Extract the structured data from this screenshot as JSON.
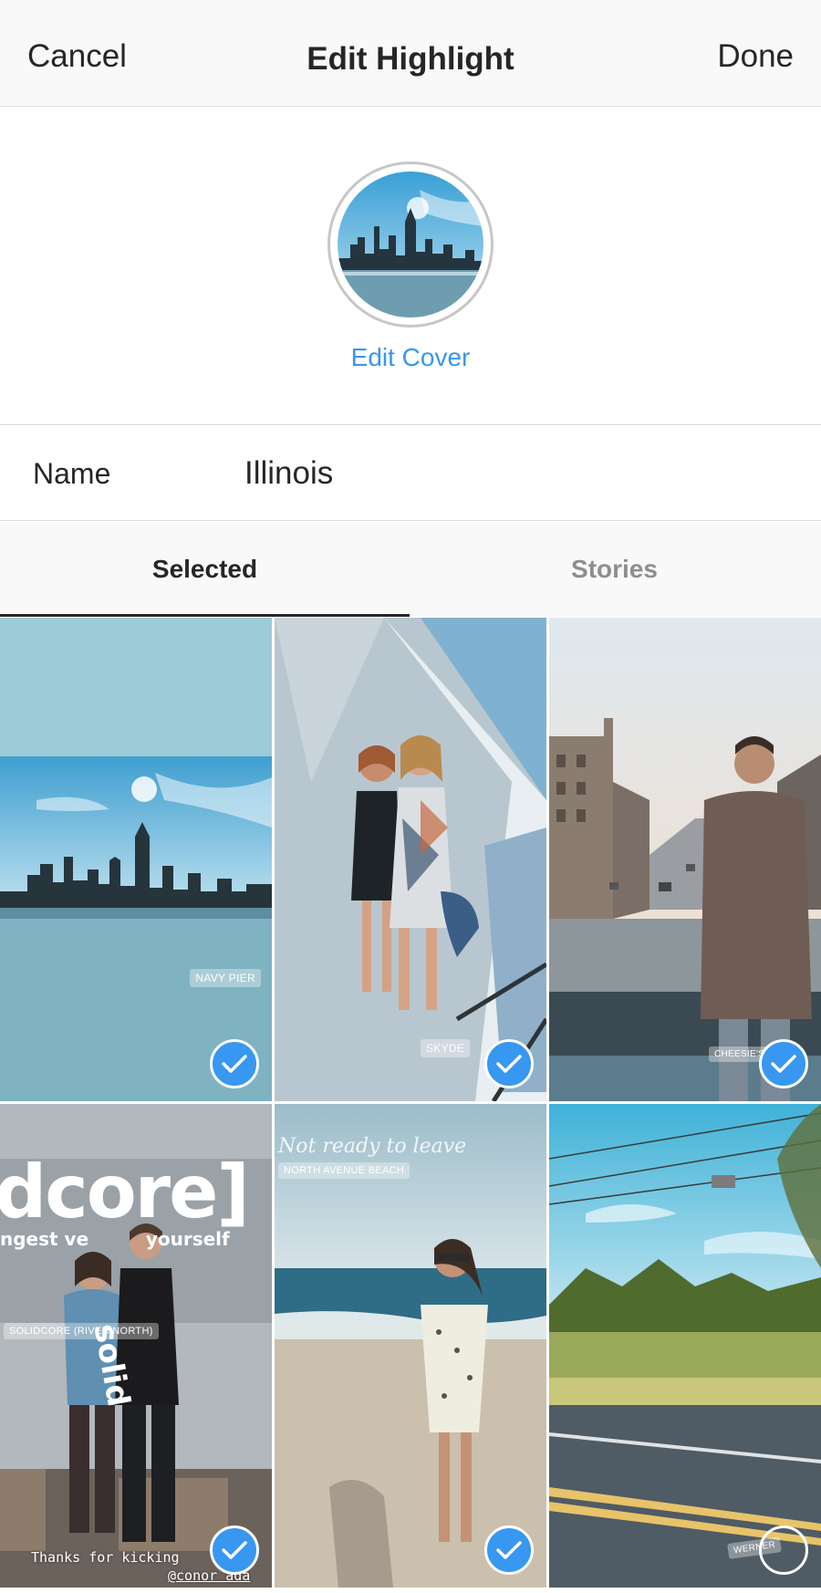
{
  "header": {
    "cancel_label": "Cancel",
    "title": "Edit Highlight",
    "done_label": "Done"
  },
  "cover": {
    "edit_label": "Edit Cover"
  },
  "name_field": {
    "label": "Name",
    "value": "Illinois"
  },
  "tabs": [
    {
      "label": "Selected",
      "active": true
    },
    {
      "label": "Stories",
      "active": false
    }
  ],
  "stories": [
    {
      "location": "NAVY PIER",
      "selected": true
    },
    {
      "location": "SKYDE",
      "selected": true
    },
    {
      "location": "CHEESIE'S PU",
      "selected": true
    },
    {
      "location": "SOLIDCORE (RIVER NORTH)",
      "sign_text": "dcore]",
      "sign_sub": "ngest ve         yourself",
      "caption_line1": "Thanks for kicking      s",
      "caption_line2": "@conor ada",
      "selected": true
    },
    {
      "location": "NORTH AVENUE BEACH",
      "script_caption": "Not ready to leave",
      "selected": true
    },
    {
      "location": "WERNER",
      "selected": false
    }
  ],
  "colors": {
    "accent": "#3897f0",
    "text": "#262626",
    "muted": "#8e8e8e",
    "border": "#dbdbdb",
    "bar_bg": "#f9f9f9"
  },
  "icons": {
    "check": "check-icon",
    "location": "location-pin-icon"
  }
}
